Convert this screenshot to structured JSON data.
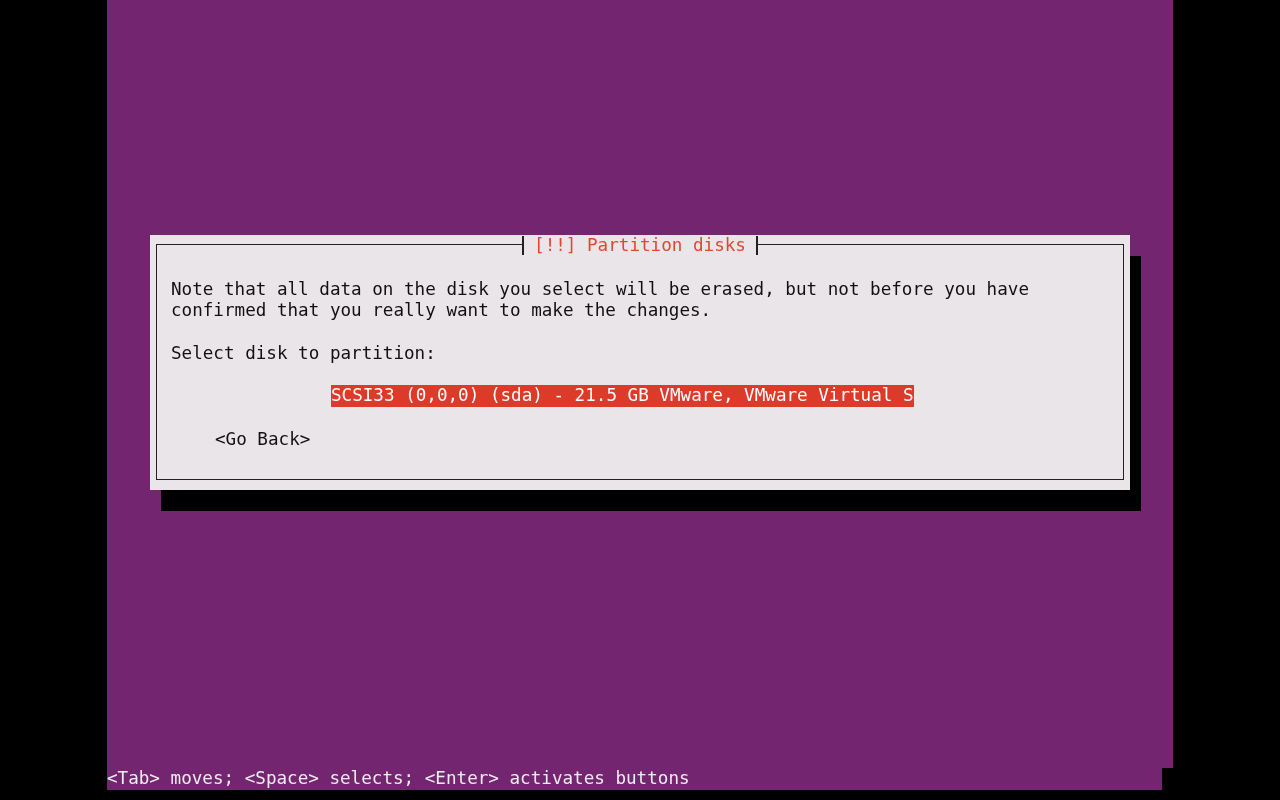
{
  "dialog": {
    "title": "[!!] Partition disks",
    "message": "Note that all data on the disk you select will be erased, but not before you have\nconfirmed that you really want to make the changes.",
    "prompt": "Select disk to partition:",
    "disks": [
      {
        "label": "SCSI33 (0,0,0) (sda) - 21.5 GB VMware, VMware Virtual S",
        "selected": true
      }
    ],
    "buttons": [
      {
        "label": "<Go Back>"
      }
    ]
  },
  "status_bar": "<Tab> moves; <Space> selects; <Enter> activates buttons"
}
